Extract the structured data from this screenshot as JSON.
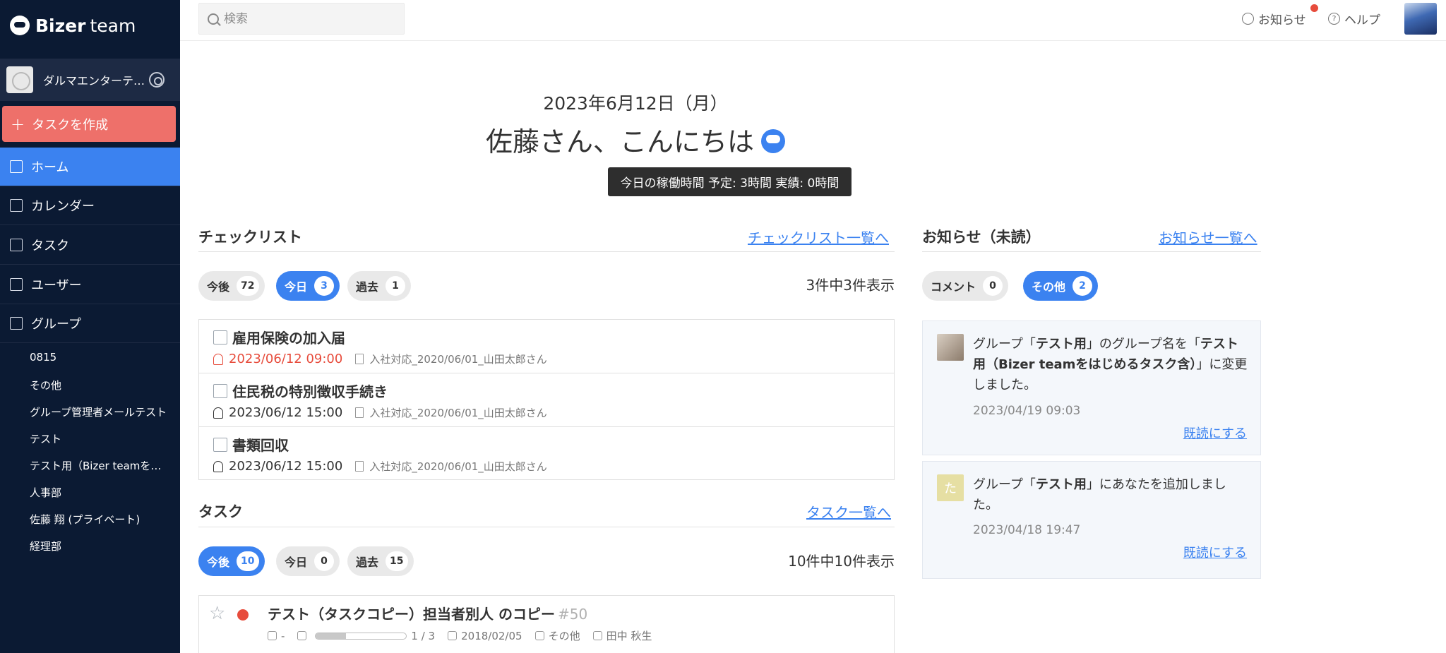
{
  "app": {
    "logo_bold": "Bizer",
    "logo_rest": "team"
  },
  "workspace": {
    "name": "ダルマエンターテイメント株式会社"
  },
  "sidebar": {
    "create_label": "タスクを作成",
    "nav": [
      {
        "label": "ホーム",
        "icon": "home-icon"
      },
      {
        "label": "カレンダー",
        "icon": "calendar-icon"
      },
      {
        "label": "タスク",
        "icon": "document-icon"
      },
      {
        "label": "ユーザー",
        "icon": "user-icon"
      },
      {
        "label": "グループ",
        "icon": "folder-icon"
      }
    ],
    "groups": [
      "0815",
      "その他",
      "グループ管理者メールテスト",
      "テスト",
      "テスト用（Bizer teamをはじめるタスク含）",
      "人事部",
      "佐藤 翔 (プライベート)",
      "経理部"
    ]
  },
  "header": {
    "search_placeholder": "検索",
    "notice_label": "お知らせ",
    "help_label": "ヘルプ"
  },
  "greeting": {
    "date": "2023年6月12日（月）",
    "hello": "佐藤さん、こんにちは",
    "work_hours": "今日の稼働時間 予定: 3時間 実績: 0時間"
  },
  "checklist": {
    "title": "チェックリスト",
    "link": "チェックリスト一覧へ",
    "tabs": [
      {
        "label": "今後",
        "count": "72"
      },
      {
        "label": "今日",
        "count": "3"
      },
      {
        "label": "過去",
        "count": "1"
      }
    ],
    "summary": "3件中3件表示",
    "items": [
      {
        "title": "雇用保険の加入届",
        "datetime": "2023/06/12 09:00",
        "group": "入社対応_2020/06/01_山田太郎さん"
      },
      {
        "title": "住民税の特別徴収手続き",
        "datetime": "2023/06/12 15:00",
        "group": "入社対応_2020/06/01_山田太郎さん"
      },
      {
        "title": "書類回収",
        "datetime": "2023/06/12 15:00",
        "group": "入社対応_2020/06/01_山田太郎さん"
      }
    ]
  },
  "tasks": {
    "title": "タスク",
    "link": "タスク一覧へ",
    "tabs": [
      {
        "label": "今後",
        "count": "10"
      },
      {
        "label": "今日",
        "count": "0"
      },
      {
        "label": "過去",
        "count": "15"
      }
    ],
    "summary": "10件中10件表示",
    "items": [
      {
        "title": "テスト（タスクコピー）担当者別人 のコピー",
        "number": "#50",
        "due": "-",
        "progress_text": "1 / 3",
        "progress": 0.33,
        "date": "2018/02/05",
        "group": "その他",
        "assignee": "田中 秋生"
      }
    ]
  },
  "notices": {
    "title": "お知らせ（未読）",
    "link": "お知らせ一覧へ",
    "tabs": [
      {
        "label": "コメント",
        "count": "0"
      },
      {
        "label": "その他",
        "count": "2"
      }
    ],
    "items": [
      {
        "t1": "グループ「",
        "b1": "テスト用",
        "t2": "」のグループ名を「",
        "b2": "テスト用（Bizer teamをはじめるタスク含）",
        "t3": "」に変更しました。",
        "time": "2023/04/19 09:03",
        "read": "既読にする"
      },
      {
        "t1": "グループ「",
        "b1": "テスト用",
        "t2": "」にあなたを追加しました。",
        "avatar_char": "た",
        "time": "2023/04/18 19:47",
        "read": "既読にする"
      }
    ]
  },
  "colors": {
    "sidebar": "#0b1a33",
    "accent": "#3b82f0",
    "create": "#ee706a",
    "alert": "#e74c3c"
  }
}
